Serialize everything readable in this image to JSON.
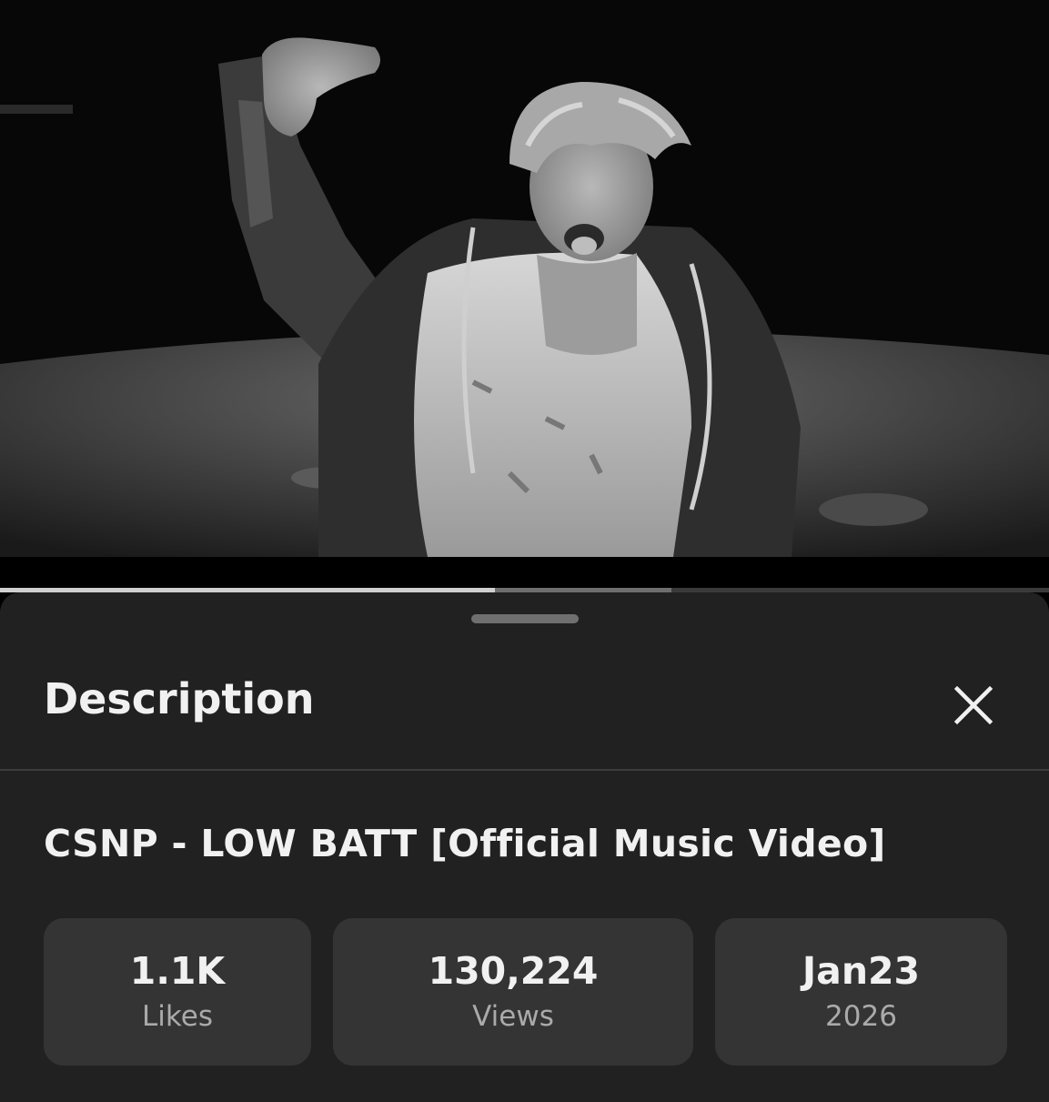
{
  "player": {
    "thumbnail": "black-and-white still of a person with tousled hair raising a fist, wearing a zip jacket over a knit sweater, dark warehouse background",
    "progress_played_fraction": 0.472,
    "progress_buffered_fraction": 0.64
  },
  "sheet": {
    "header_title": "Description",
    "close_icon": "close-icon",
    "video_title": "CSNP - LOW BATT [Official Music Video]"
  },
  "stats": {
    "likes": {
      "value": "1.1K",
      "label": "Likes"
    },
    "views": {
      "value": "130,224",
      "label": "Views"
    },
    "date": {
      "value": "Jan23",
      "label": "2026"
    }
  },
  "colors": {
    "sheet_bg": "#212121",
    "stat_bg": "#343434",
    "text_primary": "#f1f1f1",
    "text_secondary": "#aaaaaa"
  }
}
